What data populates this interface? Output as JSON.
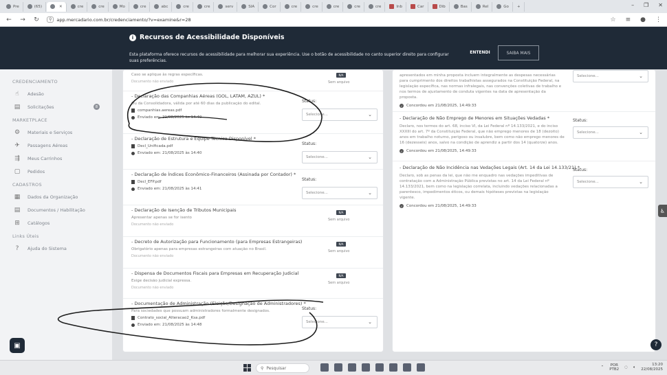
{
  "browser": {
    "tabs": [
      "Pre",
      "(65)",
      "",
      "cre",
      "cre",
      "Mo",
      "cre",
      "abc",
      "cre",
      "cre",
      "serv",
      "SIA",
      "Cor",
      "cre",
      "cre",
      "cre",
      "cre",
      "cre",
      "Inb",
      "Car",
      "Dib",
      "Bas",
      "Rel",
      "Go"
    ],
    "active_tab": "",
    "url": "app.mercadario.com.br/credenciamento/?v=examine&r=28",
    "new_tab": "+"
  },
  "banner": {
    "title": "Recursos de Acessibilidade Disponíveis",
    "description": "Esta plataforma oferece recursos de acessibilidade para melhorar sua experiência. Use o botão de acessibilidade no canto superior direito para configurar suas preferências.",
    "accept_label": "ENTENDI",
    "more_label": "SAIBA MAIS"
  },
  "sidebar": {
    "sections": [
      {
        "title": "CREDENCIAMENTO",
        "items": [
          {
            "label": "Adesão",
            "icon": "handshake-icon"
          },
          {
            "label": "Solicitações",
            "icon": "document-icon",
            "badge": "8"
          }
        ]
      },
      {
        "title": "MARKETPLACE",
        "items": [
          {
            "label": "Materiais e Serviços",
            "icon": "gears-icon"
          },
          {
            "label": "Passagens Aéreas",
            "icon": "plane-icon"
          },
          {
            "label": "Meus Carrinhos",
            "icon": "cart-icon"
          },
          {
            "label": "Pedidos",
            "icon": "orders-icon"
          }
        ]
      },
      {
        "title": "CADASTROS",
        "items": [
          {
            "label": "Dados da Organização",
            "icon": "building-icon"
          },
          {
            "label": "Documentos / Habilitação",
            "icon": "file-icon"
          },
          {
            "label": "Catálogos",
            "icon": "catalog-icon"
          }
        ]
      },
      {
        "title": "Links Úteis",
        "items": [
          {
            "label": "Ajuda do Sistema",
            "icon": "help-icon"
          }
        ]
      }
    ]
  },
  "left_docs": [
    {
      "title": "",
      "sub": "Caso se aplique às regras específicas.",
      "warn": "Documento não enviado",
      "na": "N/A",
      "noarq": "Sem arquivo"
    },
    {
      "title": "- Declaração das Companhias Aéreas (GOL, LATAM, AZUL) *",
      "sub": "Ou da Consolidadora, válida por até 60 dias da publicação do edital.",
      "file": "companhias.aereas.pdf",
      "sent": "Enviado em: 21/08/2025 às 14:40",
      "status": "Status:",
      "select": "Selecione..."
    },
    {
      "title": "- Declaração de Estrutura e Equipe Técnica Disponível *",
      "file": "Decl_Unificada.pdf",
      "sent": "Enviado em: 21/08/2025 às 14:40",
      "status": "Status:",
      "select": "Selecione..."
    },
    {
      "title": "- Declaração de Índices Econômico-Financeiros (Assinada por Contador) *",
      "file": "Decl_EFP.pdf",
      "sent": "Enviado em: 21/08/2025 às 14:41",
      "status": "Status:",
      "select": "Selecione..."
    },
    {
      "title": "- Declaração de Isenção de Tributos Municipais",
      "sub": "Apresentar apenas se for isento",
      "warn": "Documento não enviado",
      "na": "N/A",
      "noarq": "Sem arquivo"
    },
    {
      "title": "- Decreto de Autorização para Funcionamento (para Empresas Estrangeiras)",
      "sub": "Obrigatório apenas para empresas estrangeiras com atuação no Brasil.",
      "warn": "Documento não enviado",
      "na": "N/A",
      "noarq": "Sem arquivo"
    },
    {
      "title": "- Dispensa de Documentos Fiscais para Empresas em Recuperação Judicial",
      "sub": "Exige decisão judicial expressa.",
      "warn": "Documento não enviado",
      "na": "N/A",
      "noarq": "Sem arquivo"
    },
    {
      "title": "- Documentação de Administração (Eleição/Designação de Administradores) *",
      "sub": "Para sociedades que possuam administradores formalmente designados.",
      "file": "Contrato_social_Alteracao2_Ksa.pdf",
      "sent": "Enviado em: 21/08/2025 às 14:48",
      "status": "Status:",
      "select": "Selecione..."
    }
  ],
  "right_docs": [
    {
      "title": "",
      "desc": "apresentados em minha proposta incluem integralmente as despesas necessárias para cumprimento dos direitos trabalhistas assegurados na Constituição Federal, na legislação específica, nas normas infralegais, nas convenções coletivas de trabalho e nos termos de ajustamento de conduta vigentes na data de apresentação da proposta.",
      "agree": "Concordou em 21/08/2025, 14:49:33",
      "select": "Selecione..."
    },
    {
      "title": "- Declaração de Não Emprego de Menores em Situações Vedadas *",
      "desc": "Declaro, nos termos do art. 68, inciso VI, da Lei Federal nº 14.133/2021, e do inciso XXXIII do art. 7º da Constituição Federal, que não emprego menores de 18 (dezoito) anos em trabalho noturno, perigoso ou insalubre, bem como não emprego menores de 16 (dezesseis) anos, salvo na condição de aprendiz a partir dos 14 (quatorze) anos.",
      "agree": "Concordou em 21/08/2025, 14:49:33",
      "status": "Status:",
      "select": "Selecione..."
    },
    {
      "title": "- Declaração de Não Incidência nas Vedações Legais (Art. 14 da Lei 14.133/21) *",
      "desc": "Declaro, sob as penas da lei, que não me enquadro nas vedações impeditivas de contratação com a Administração Pública previstas no art. 14 da Lei Federal nº 14.133/2021, bem como na legislação correlata, incluindo vedações relacionadas a parentesco, impedimentos éticos, ou demais hipóteses previstas na legislação vigente.",
      "agree": "Concordou em 21/08/2025, 14:49:33",
      "status": "Status:",
      "select": "Selecione..."
    }
  ],
  "taskbar": {
    "search": "Pesquisar",
    "lang": "POR",
    "lang2": "PTB2",
    "time": "13:20",
    "date": "22/08/2025"
  }
}
